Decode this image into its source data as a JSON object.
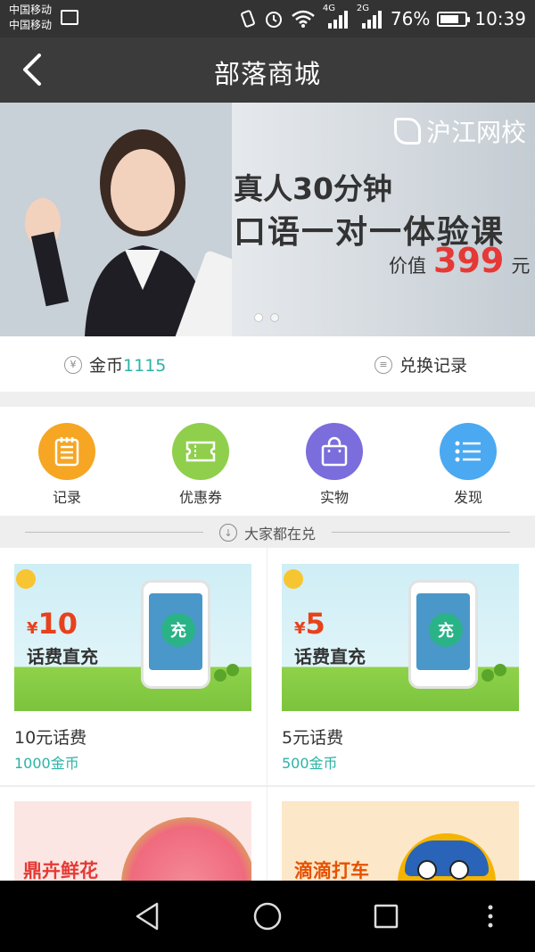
{
  "status_bar": {
    "carrier1": "中国移动",
    "carrier2": "中国移动",
    "network1": "4G",
    "network2": "2G",
    "battery": "76%",
    "battery_level": 0.76,
    "time": "10:39"
  },
  "header": {
    "title": "部落商城",
    "back_icon": "back-arrow-icon"
  },
  "banner": {
    "logo_text": "沪江网校",
    "line1": "真人30分钟",
    "line2": "口语一对一体验课",
    "price_prefix": "价值",
    "price": "399",
    "price_suffix": "元",
    "slides": 2,
    "active_slide": 0
  },
  "coins": {
    "label": "金币",
    "value": "1115",
    "exchange_label": "兑换记录",
    "coin_icon_glyph": "¥",
    "exchange_icon_glyph": "≡"
  },
  "categories": [
    {
      "label": "记录",
      "icon": "notepad-icon",
      "color": "#f6a623"
    },
    {
      "label": "优惠券",
      "icon": "ticket-icon",
      "color": "#8fcf4c"
    },
    {
      "label": "实物",
      "icon": "shopping-bag-icon",
      "color": "#7b6ddc"
    },
    {
      "label": "发现",
      "icon": "list-icon",
      "color": "#4aa9f0"
    }
  ],
  "section": {
    "title": "大家都在兑",
    "icon_glyph": "↓"
  },
  "products": [
    {
      "name": "10元话费",
      "price": "1000金币",
      "banner_amount_symbol": "¥",
      "banner_amount": "10",
      "banner_text": "话费直充",
      "phone_text": "充"
    },
    {
      "name": "5元话费",
      "price": "500金币",
      "banner_amount_symbol": "¥",
      "banner_amount": "5",
      "banner_text": "话费直充",
      "phone_text": "充"
    },
    {
      "banner_text": "鼎卉鲜花"
    },
    {
      "banner_text": "滴滴打车"
    }
  ],
  "colors": {
    "accent": "#2bb3a6",
    "price_red": "#e53935",
    "status_bar": "#333333",
    "title_bar": "#3b3b3b"
  }
}
